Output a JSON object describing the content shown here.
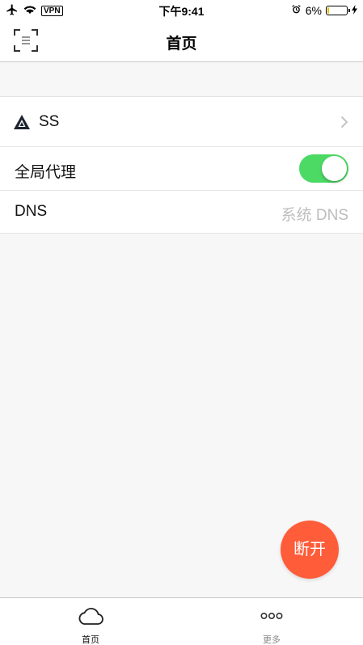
{
  "status_bar": {
    "vpn": "VPN",
    "time": "下午9:41",
    "battery_percent": "6%",
    "battery_level": 0.06,
    "icons": [
      "airplane-icon",
      "wifi-icon",
      "alarm-icon",
      "battery-icon",
      "charging-bolt-icon"
    ]
  },
  "nav": {
    "title": "首页",
    "left_icon": "scan-icon"
  },
  "list": {
    "server": {
      "label": "SS",
      "icon": "server-logo-icon"
    },
    "global_proxy": {
      "label": "全局代理",
      "enabled": true
    },
    "dns": {
      "label": "DNS",
      "value": "系统 DNS"
    }
  },
  "fab": {
    "label": "断开",
    "color": "#ff5c3a"
  },
  "tabs": [
    {
      "label": "首页",
      "icon": "cloud-icon",
      "active": true
    },
    {
      "label": "更多",
      "icon": "more-icon",
      "active": false
    }
  ],
  "colors": {
    "toggle_on": "#4cd964",
    "fab": "#ff5c3a",
    "battery_low": "#e6c400"
  }
}
